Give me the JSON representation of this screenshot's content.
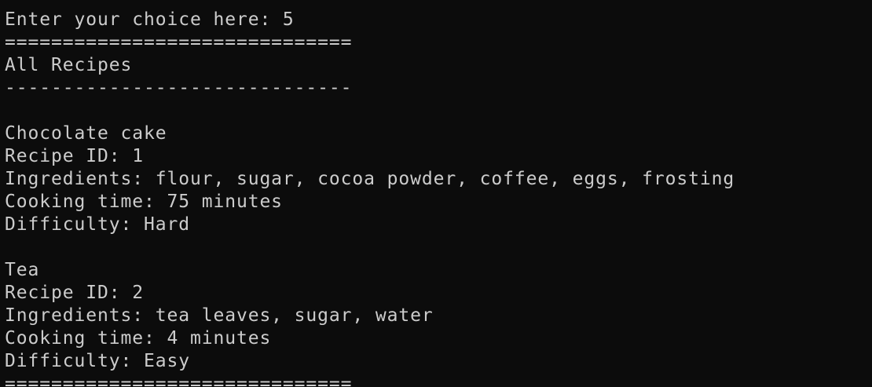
{
  "terminal": {
    "background_color": "#0c0c0c",
    "text_color": "#cccccc",
    "lines": [
      "Enter your choice here: 5",
      "==============================",
      "All Recipes",
      "------------------------------",
      "",
      "Chocolate cake",
      "Recipe ID: 1",
      "Ingredients: flour, sugar, cocoa powder, coffee, eggs, frosting",
      "Cooking time: 75 minutes",
      "Difficulty: Hard",
      "",
      "Tea",
      "Recipe ID: 2",
      "Ingredients: tea leaves, sugar, water",
      "Cooking time: 4 minutes",
      "Difficulty: Easy",
      "=============================="
    ]
  }
}
